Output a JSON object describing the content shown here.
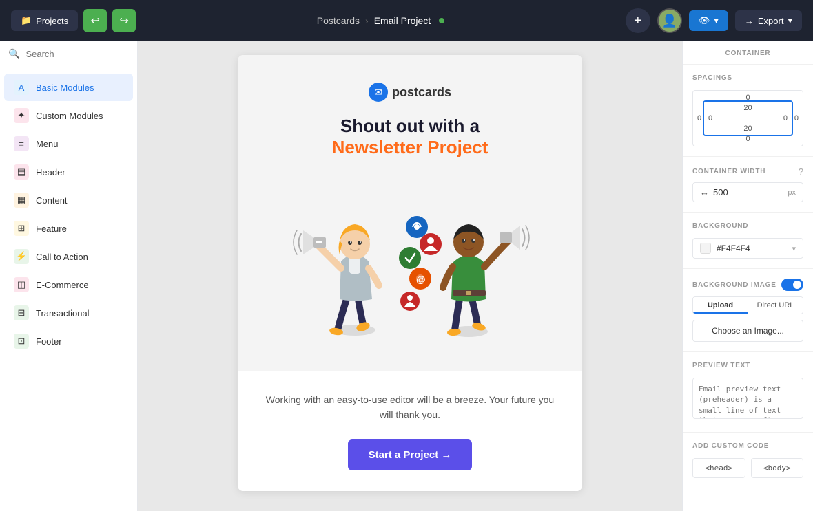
{
  "topbar": {
    "projects_label": "Projects",
    "undo_icon": "↩",
    "redo_icon": "↪",
    "breadcrumb_parent": "Postcards",
    "breadcrumb_sep": "›",
    "breadcrumb_current": "Email Project",
    "add_icon": "+",
    "view_icon": "👁",
    "view_label": "",
    "export_icon": "→",
    "export_label": "Export"
  },
  "sidebar": {
    "search_placeholder": "Search",
    "items": [
      {
        "id": "basic-modules",
        "label": "Basic Modules",
        "icon": "A",
        "active": true
      },
      {
        "id": "custom-modules",
        "label": "Custom Modules",
        "icon": "✦",
        "active": false
      },
      {
        "id": "menu",
        "label": "Menu",
        "icon": "≡",
        "active": false
      },
      {
        "id": "header",
        "label": "Header",
        "icon": "▤",
        "active": false
      },
      {
        "id": "content",
        "label": "Content",
        "icon": "▦",
        "active": false
      },
      {
        "id": "feature",
        "label": "Feature",
        "icon": "⊞",
        "active": false
      },
      {
        "id": "call-to-action",
        "label": "Call to Action",
        "icon": "⚡",
        "active": false
      },
      {
        "id": "e-commerce",
        "label": "E-Commerce",
        "icon": "◫",
        "active": false
      },
      {
        "id": "transactional",
        "label": "Transactional",
        "icon": "⊟",
        "active": false
      },
      {
        "id": "footer",
        "label": "Footer",
        "icon": "⊡",
        "active": false
      }
    ]
  },
  "email": {
    "logo_text": "postcards",
    "headline_line1": "Shout out with a",
    "headline_line2": "Newsletter Project",
    "desc": "Working with an easy-to-use editor will be a breeze. Your future you will thank you.",
    "cta_label": "Start a Project →"
  },
  "right_panel": {
    "container_title": "CONTAINER",
    "spacings_title": "SPACINGS",
    "spacing_top_outer": "0",
    "spacing_bottom_outer": "0",
    "spacing_left_outer": "0",
    "spacing_right_outer": "0",
    "spacing_top_inner": "20",
    "spacing_bottom_inner": "20",
    "spacing_left_inner": "0",
    "spacing_right_inner": "0",
    "container_width_title": "CONTAINER WIDTH",
    "container_width_value": "500",
    "container_width_unit": "px",
    "background_title": "BACKGROUND",
    "bg_color": "#F4F4F4",
    "bg_image_title": "BACKGROUND IMAGE",
    "upload_label": "Upload",
    "direct_url_label": "Direct URL",
    "choose_image_label": "Choose an Image...",
    "preview_text_title": "PREVIEW TEXT",
    "preview_text_placeholder": "Email preview text (preheader) is a small line of text that appears after the subject line in the inbox.",
    "custom_code_title": "ADD CUSTOM CODE",
    "head_label": "<head>",
    "body_label": "<body>"
  }
}
